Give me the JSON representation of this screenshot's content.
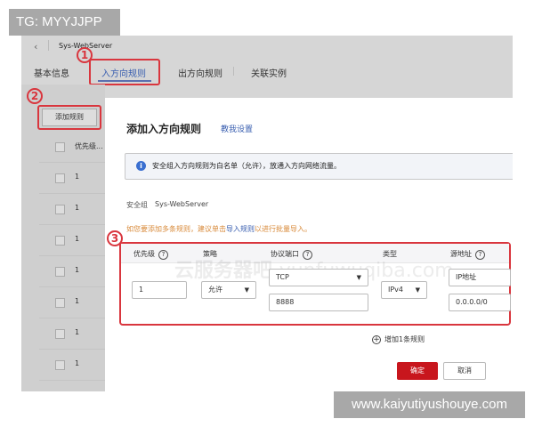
{
  "overlay": {
    "tag_label": "TG: MYYJJPP",
    "watermark_url": "www.kaiyutiyushouye.com",
    "site_watermark_cn": "云服务器吧",
    "site_watermark_en": "yunfuwuqiba.com"
  },
  "header": {
    "back_icon": "chevron-left-icon",
    "title": "Sys-WebServer"
  },
  "tabs": [
    {
      "label": "基本信息"
    },
    {
      "label": "入方向规则",
      "active": true
    },
    {
      "label": "出方向规则"
    },
    {
      "label": "关联实例"
    }
  ],
  "steps": [
    "1",
    "2",
    "3"
  ],
  "left_list": {
    "add_button": "添加规则",
    "header": "优先级...",
    "rows": [
      "1",
      "1",
      "1",
      "1",
      "1",
      "1",
      "1"
    ]
  },
  "drawer": {
    "title": "添加入方向规则",
    "help_link": "教我设置",
    "info_text": "安全组入方向规则为白名单（允许），放通入方向网络流量。",
    "security_group_label": "安全组",
    "security_group_value": "Sys-WebServer",
    "hint_prefix": "如您要添加多条规则，建议单击",
    "hint_link": "导入规则",
    "hint_suffix": "以进行批量导入。",
    "columns": {
      "priority": "优先级",
      "action": "策略",
      "protocol_port": "协议端口",
      "type": "类型",
      "source": "源地址"
    },
    "rule": {
      "priority": "1",
      "action": "允许",
      "protocol": "TCP",
      "port": "8888",
      "type": "IPv4",
      "source_type": "IP地址",
      "source": "0.0.0.0/0"
    },
    "add_rule": "增加1条规则",
    "confirm": "确定",
    "cancel": "取消"
  },
  "colors": {
    "accent_red": "#c8161d",
    "highlight_red": "#d9363e",
    "link_blue": "#3a5fb0",
    "hint_orange": "#d88a3a"
  }
}
